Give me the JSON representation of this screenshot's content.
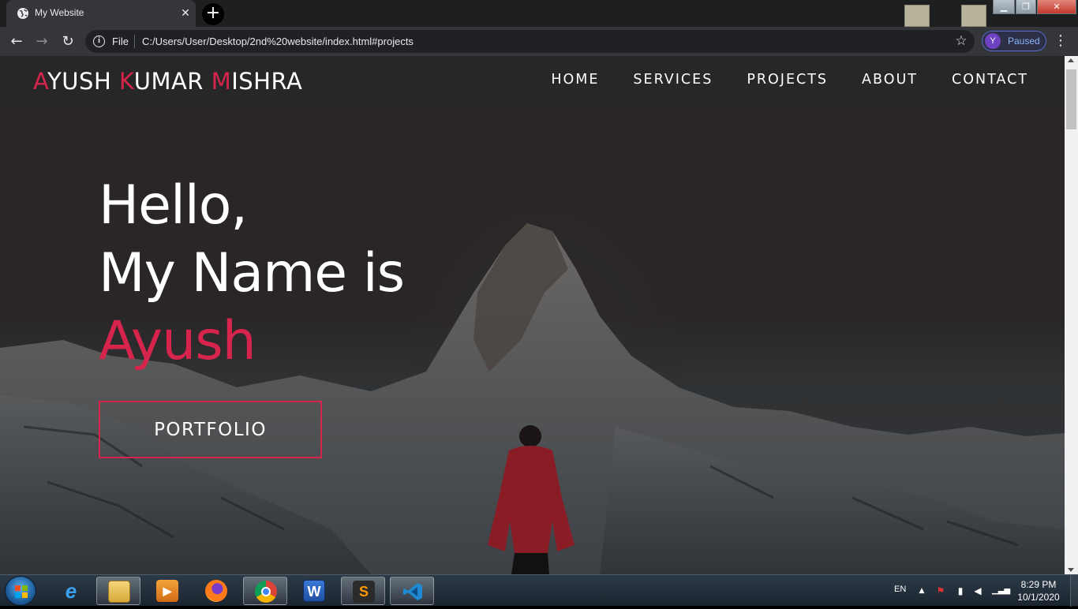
{
  "browser": {
    "tab": {
      "title": "My Website",
      "favicon": "globe-icon",
      "close_icon": "close-icon"
    },
    "new_tab_icon": "plus-icon",
    "toolbar": {
      "back_icon": "arrow-left-icon",
      "forward_icon": "arrow-right-icon",
      "reload_icon": "reload-icon",
      "scheme_label": "File",
      "url": "C:/Users/User/Desktop/2nd%20website/index.html#projects",
      "bookmark_icon": "star-icon",
      "profile": {
        "initial": "Y",
        "status": "Paused"
      },
      "menu_icon": "kebab-menu-icon"
    }
  },
  "site": {
    "brand": [
      {
        "text": "A",
        "accent": true
      },
      {
        "text": "YUSH ",
        "accent": false
      },
      {
        "text": "K",
        "accent": true
      },
      {
        "text": "UMAR ",
        "accent": false
      },
      {
        "text": "M",
        "accent": true
      },
      {
        "text": "ISHRA",
        "accent": false
      }
    ],
    "nav": [
      "HOME",
      "SERVICES",
      "PROJECTS",
      "ABOUT",
      "CONTACT"
    ],
    "hero": {
      "line1": "Hello,",
      "line2": "My Name is",
      "name": "Ayush",
      "button": "PORTFOLIO"
    }
  },
  "taskbar": {
    "apps": [
      {
        "name": "internet-explorer-icon",
        "glyph": "e",
        "active": false
      },
      {
        "name": "file-explorer-icon",
        "glyph": "",
        "active": true
      },
      {
        "name": "media-player-icon",
        "glyph": "▶",
        "active": false
      },
      {
        "name": "firefox-icon",
        "glyph": "",
        "active": false
      },
      {
        "name": "chrome-icon",
        "glyph": "",
        "active": true
      },
      {
        "name": "word-icon",
        "glyph": "W",
        "active": false
      },
      {
        "name": "sublime-text-icon",
        "glyph": "S",
        "active": true
      },
      {
        "name": "vscode-icon",
        "glyph": "",
        "active": true
      }
    ],
    "language": "EN",
    "time": "8:29 PM",
    "date": "10/1/2020"
  },
  "colors": {
    "accent": "#d6244d",
    "browser_bar": "#35363a",
    "taskbar": "#1b2530"
  }
}
